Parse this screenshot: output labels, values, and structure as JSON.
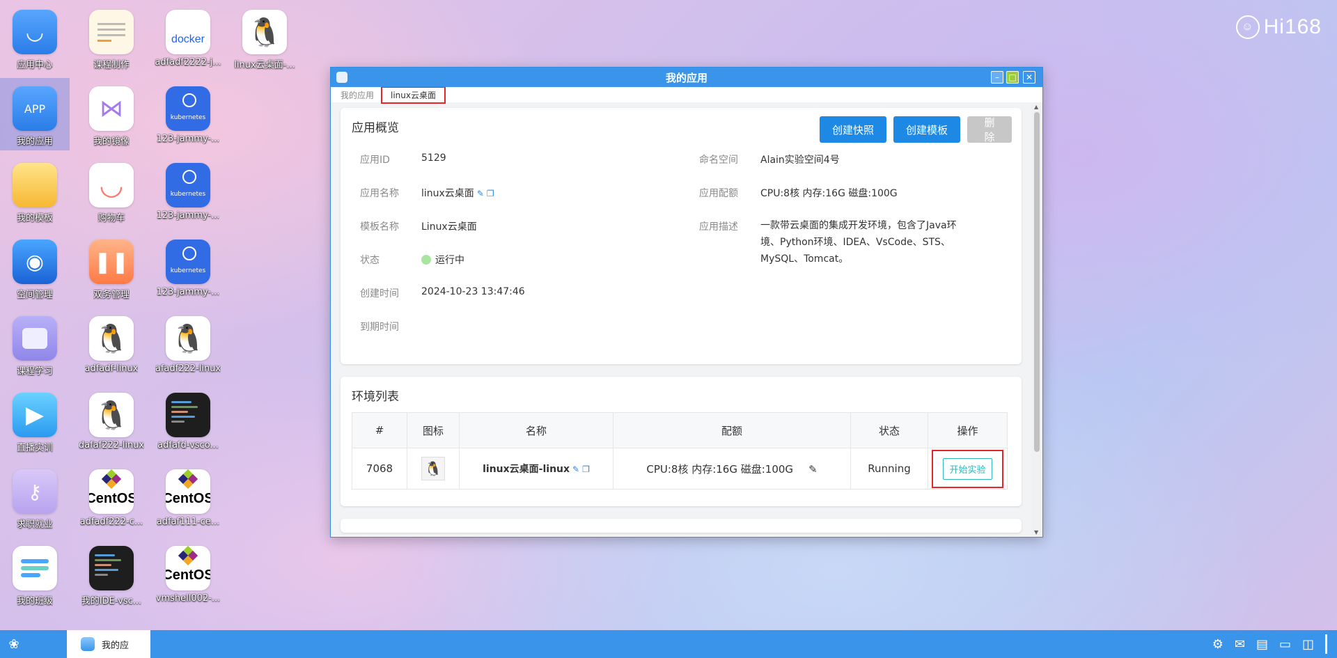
{
  "brand": {
    "text": "Hi168"
  },
  "desktop_icons": [
    {
      "label": "应用中心"
    },
    {
      "label": "课程制作"
    },
    {
      "label": "adfadf2222-j..."
    },
    {
      "label": "linux云桌面-..."
    },
    {
      "label": "我的应用"
    },
    {
      "label": "我的镜像"
    },
    {
      "label": "123-jammy-..."
    },
    {
      "label": "我的模板"
    },
    {
      "label": "购物车"
    },
    {
      "label": "123-jammy-..."
    },
    {
      "label": "空间管理"
    },
    {
      "label": "双务管理"
    },
    {
      "label": "123-jammy-..."
    },
    {
      "label": "课程学习"
    },
    {
      "label": "adfadf-linux"
    },
    {
      "label": "afadf222-linux"
    },
    {
      "label": "直播实训"
    },
    {
      "label": "dafaf222-linux"
    },
    {
      "label": "adfafd-vsco..."
    },
    {
      "label": "求职就业"
    },
    {
      "label": "adfadf222-c..."
    },
    {
      "label": "adfaf111-ce..."
    },
    {
      "label": "我的班级"
    },
    {
      "label": "我的IDE-vsc..."
    },
    {
      "label": "vmshell002-..."
    }
  ],
  "app_tile_text": "APP",
  "docker_text": "docker",
  "kubernetes_text": "kubernetes",
  "centos_text": "CentOS",
  "window": {
    "title": "我的应用",
    "breadcrumb": [
      "我的应用",
      "linux云桌面"
    ]
  },
  "overview": {
    "title": "应用概览",
    "buttons": {
      "snapshot": "创建快照",
      "template": "创建模板",
      "delete": "删除"
    },
    "left": [
      {
        "key": "应用ID",
        "value": "5129"
      },
      {
        "key": "应用名称",
        "value": "linux云桌面"
      },
      {
        "key": "模板名称",
        "value": "Linux云桌面"
      },
      {
        "key": "状态",
        "value": "运行中"
      },
      {
        "key": "创建时间",
        "value": "2024-10-23 13:47:46"
      },
      {
        "key": "到期时间",
        "value": ""
      }
    ],
    "right": [
      {
        "key": "命名空间",
        "value": "Alain实验空间4号"
      },
      {
        "key": "应用配额",
        "value": "CPU:8核 内存:16G 磁盘:100G"
      },
      {
        "key": "应用描述",
        "value": "一款带云桌面的集成开发环境，包含了Java环境、Python环境、IDEA、VsCode、STS、MySQL、Tomcat。"
      }
    ],
    "desc_lines": [
      "一款带云桌面的集成开发环境，包含了Java环",
      "境、Python环境、IDEA、VsCode、STS、",
      "MySQL、Tomcat。"
    ]
  },
  "env": {
    "title": "环境列表",
    "columns": [
      "#",
      "图标",
      "名称",
      "配额",
      "状态",
      "操作"
    ],
    "rows": [
      {
        "id": "7068",
        "name": "linux云桌面-linux",
        "quota": "CPU:8核 内存:16G 磁盘:100G",
        "status": "Running",
        "action": "开始实验"
      }
    ]
  },
  "taskbar": {
    "task_label": "我的应"
  },
  "colors": {
    "accent": "#3a95ea",
    "button": "#1e88e5",
    "highlight": "#e5252a",
    "running_dot": "#a8e6a0"
  }
}
